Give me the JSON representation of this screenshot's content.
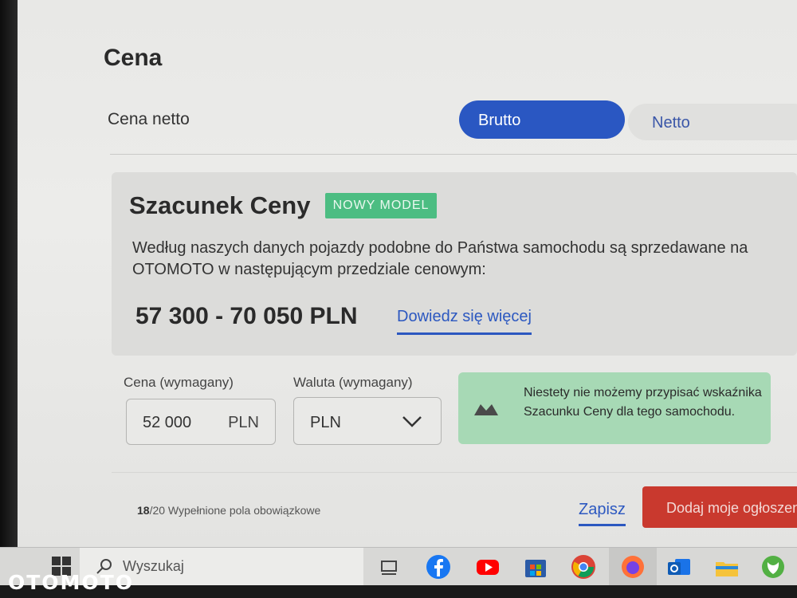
{
  "page": {
    "title": "Cena",
    "vat_label": "Cena netto",
    "vat_options": [
      "Brutto",
      "Netto"
    ],
    "vat_selected": "Brutto"
  },
  "estimate": {
    "title": "Szacunek Ceny",
    "badge": "NOWY MODEL",
    "description": "Według naszych danych pojazdy podobne do Państwa samochodu są sprzedawane na OTOMOTO w następującym przedziale cenowym:",
    "range": "57 300 - 70 050 PLN",
    "learn_more": "Dowiedz się więcej"
  },
  "form": {
    "price_label": "Cena (wymagany)",
    "price_value": "52 000",
    "price_unit": "PLN",
    "currency_label": "Waluta (wymagany)",
    "currency_value": "PLN"
  },
  "notice": {
    "text": "Niestety nie możemy przypisać wskaźnika Szacunku Ceny dla tego samochodu."
  },
  "footer": {
    "filled_count": "18",
    "filled_total": "/20 Wypełnione pola obowiązkowe",
    "save_label": "Zapisz",
    "submit_label": "Dodaj moje ogłoszenie"
  },
  "taskbar": {
    "search_placeholder": "Wyszukaj",
    "apps": [
      "task-view",
      "facebook",
      "youtube",
      "microsoft-store",
      "chrome",
      "firefox",
      "outlook",
      "file-explorer",
      "xbox"
    ]
  },
  "watermark": {
    "text": "OTOMOTO"
  },
  "colors": {
    "primary": "#2a57c2",
    "badge_green": "#4cbd82",
    "notice_bg": "#a7d9b5",
    "submit_red": "#c9392e"
  }
}
